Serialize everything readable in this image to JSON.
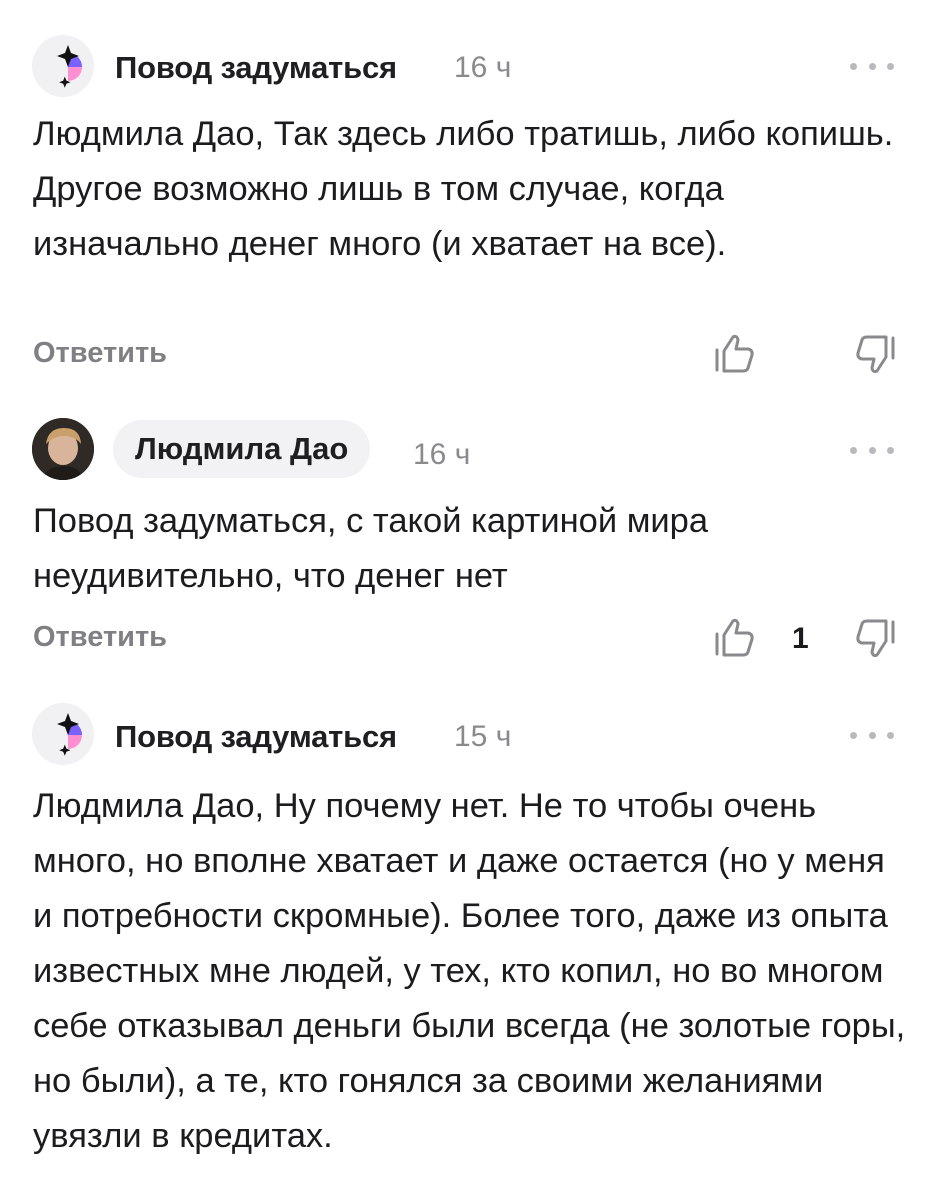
{
  "comments": [
    {
      "author": "Повод задуматься",
      "time": "16 ч",
      "text": "Людмила Дао, Так здесь либо тратишь, либо копишь. Другое возможно лишь в том случае, когда изначально денег много (и хватает на все).",
      "reply_label": "Ответить",
      "likes": "",
      "avatar_icon": "brand-logo-icon"
    },
    {
      "author": "Людмила Дао",
      "time": "16 ч",
      "text": "Повод задуматься, с такой картиной мира неудивительно, что денег нет",
      "reply_label": "Ответить",
      "likes": "1",
      "avatar_icon": "user-photo"
    },
    {
      "author": "Повод задуматься",
      "time": "15 ч",
      "text": "Людмила Дао, Ну почему нет. Не то чтобы очень много, но вполне хватает и даже остается (но у меня и потребности скромные). Более того, даже из опыта известных мне людей, у тех, кто копил, но во многом себе отказывал деньги были всегда (не золотые горы, но были), а те, кто гонялся за своими желаниями увязли в кредитах.",
      "reply_label": "",
      "likes": "",
      "avatar_icon": "brand-logo-icon"
    }
  ],
  "icons": {
    "like": "thumbs-up-icon",
    "dislike": "thumbs-down-icon",
    "more": "more-dots-icon"
  },
  "colors": {
    "logo_purple": "#7b61ff",
    "logo_pink": "#ff8fd0",
    "muted": "#8a8a8e"
  }
}
